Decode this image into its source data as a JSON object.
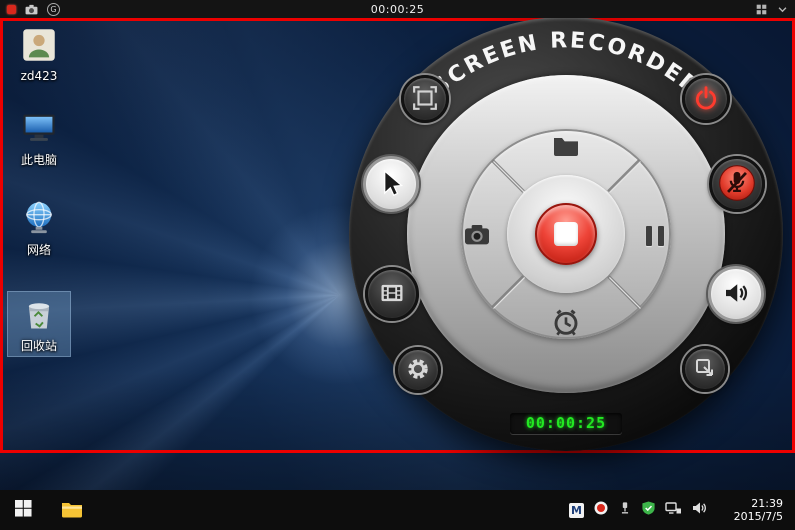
{
  "topbar": {
    "timer": "00:00:25",
    "g_label": "G",
    "left_icons": [
      "record-icon",
      "camera-icon",
      "g-icon"
    ],
    "right_icons": [
      "layout-icon",
      "chevron-down-icon"
    ]
  },
  "recorder": {
    "title": "SCREEN RECORDER",
    "timer": "00:00:25",
    "buttons": [
      "select-region",
      "cursor",
      "video",
      "settings",
      "power",
      "mute-mic",
      "speaker",
      "snapshot",
      "open-folder",
      "camera",
      "pause",
      "schedule",
      "stop"
    ]
  },
  "desktop_icons": [
    {
      "label": "zd423",
      "icon": "user-icon",
      "selected": false
    },
    {
      "label": "此电脑",
      "icon": "computer-icon",
      "selected": false
    },
    {
      "label": "网络",
      "icon": "globe-icon",
      "selected": false
    },
    {
      "label": "回收站",
      "icon": "recycle-bin-icon",
      "selected": true
    }
  ],
  "taskbar": {
    "time": "21:39",
    "date": "2015/7/5",
    "m_badge": "M",
    "tray_icons": [
      "m-icon",
      "recorder-dot-icon",
      "device-icon",
      "shield-icon",
      "network-icon",
      "volume-icon"
    ]
  },
  "colors": {
    "region_border": "#ec0000",
    "lcd_green": "#22e822",
    "record_red": "#d8281c",
    "wallpaper_blue": "#0d2344"
  }
}
